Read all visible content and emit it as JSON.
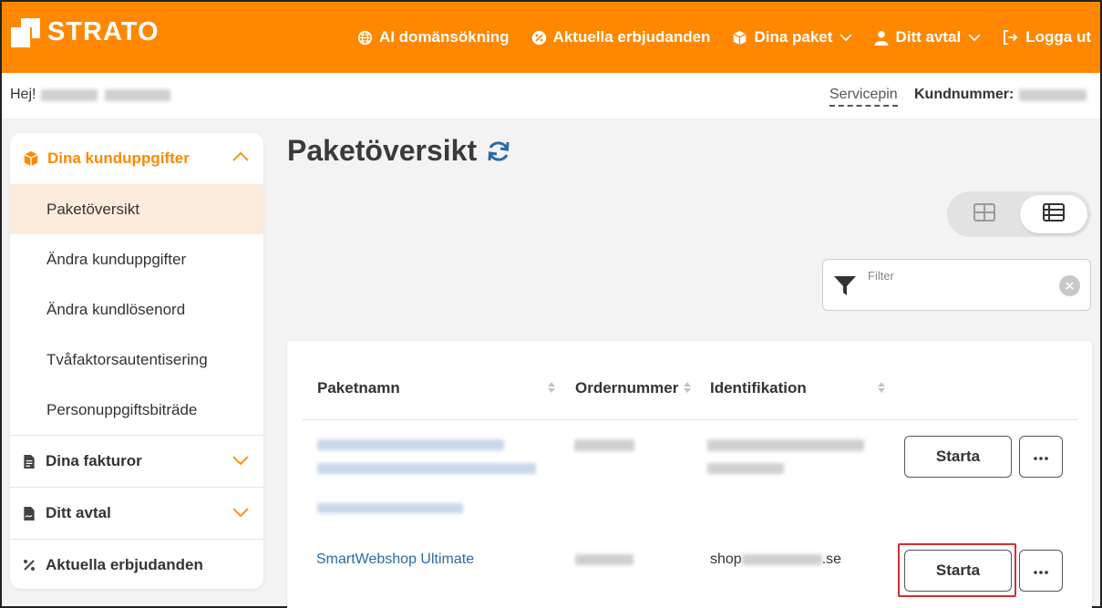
{
  "brand": {
    "name": "STRATO",
    "accent": "#ff8800"
  },
  "topnav": {
    "items": [
      {
        "label": "AI domänsökning",
        "icon": "globe-icon"
      },
      {
        "label": "Aktuella erbjudanden",
        "icon": "percent-badge-icon"
      },
      {
        "label": "Dina paket",
        "icon": "package-icon",
        "dropdown": true
      },
      {
        "label": "Ditt avtal",
        "icon": "user-icon",
        "dropdown": true
      },
      {
        "label": "Logga ut",
        "icon": "logout-icon"
      }
    ]
  },
  "subbar": {
    "greeting": "Hej!",
    "servicepin": "Servicepin",
    "customer_number_label": "Kundnummer:"
  },
  "sidebar": {
    "section_open": {
      "label": "Dina kunduppgifter",
      "icon": "package-icon"
    },
    "subitems": [
      {
        "label": "Paketöversikt",
        "active": true
      },
      {
        "label": "Ändra kunduppgifter"
      },
      {
        "label": "Ändra kundlösenord"
      },
      {
        "label": "Tvåfaktorsautentisering"
      },
      {
        "label": "Personuppgiftsbiträde"
      }
    ],
    "sections": [
      {
        "label": "Dina fakturor",
        "icon": "invoice-icon",
        "chevron": true
      },
      {
        "label": "Ditt avtal",
        "icon": "contract-icon",
        "chevron": true
      },
      {
        "label": "Aktuella erbjudanden",
        "icon": "percent-icon",
        "chevron": false
      }
    ]
  },
  "main": {
    "title": "Paketöversikt",
    "filter": {
      "placeholder": "Filter"
    },
    "table": {
      "columns": [
        "Paketnamn",
        "Ordernummer",
        "Identifikation"
      ],
      "rows": [
        {
          "name": "",
          "order": "",
          "identification": "",
          "action": "Starta"
        },
        {
          "name": "SmartWebshop Ultimate",
          "order": "",
          "identification": "shop",
          "identification_suffix": ".se",
          "action": "Starta"
        }
      ]
    }
  }
}
